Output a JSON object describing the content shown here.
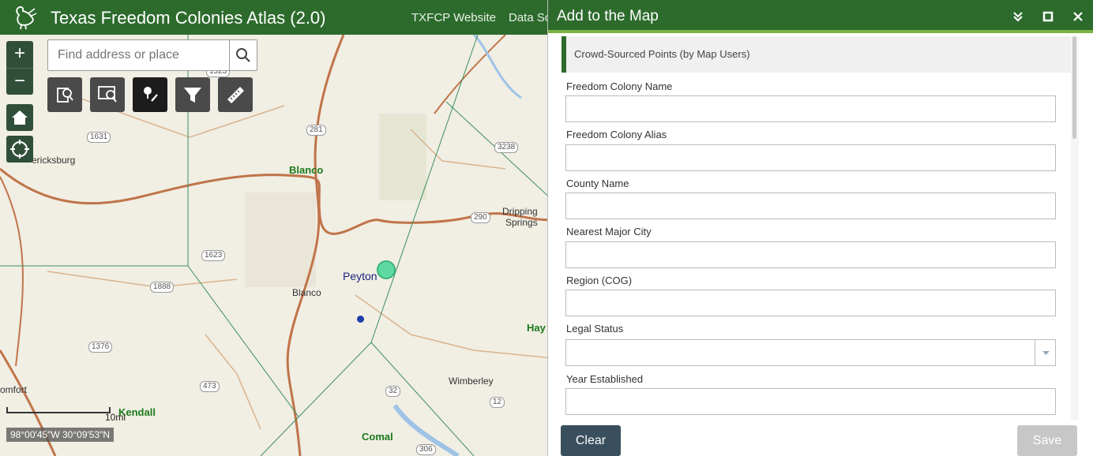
{
  "header": {
    "title": "Texas Freedom Colonies Atlas (2.0)",
    "links": [
      "TXFCP Website",
      "Data Sc"
    ]
  },
  "search": {
    "placeholder": "Find address or place"
  },
  "map": {
    "places": {
      "blanco_green": "Blanco",
      "blanco_town": "Blanco",
      "peyton": "Peyton",
      "dripping_springs_1": "Dripping",
      "dripping_springs_2": "Springs",
      "fredericksburg": "ericksburg",
      "comfort": "omfort",
      "kendall": "Kendall",
      "comal": "Comal",
      "wimberley": "Wimberley",
      "hays": "Hay"
    },
    "shields": [
      "1323",
      "281",
      "1631",
      "3238",
      "290",
      "1623",
      "1888",
      "1376",
      "473",
      "32",
      "12",
      "306"
    ],
    "scale_label": "10mi",
    "coordinates": "98°00′45″W 30°09′53″N"
  },
  "panel": {
    "title": "Add to the Map",
    "layer": "Crowd-Sourced Points (by Map Users)",
    "fields": [
      "Freedom Colony Name",
      "Freedom Colony Alias",
      "County Name",
      "Nearest Major City",
      "Region (COG)",
      "Legal Status",
      "Year Established"
    ],
    "clear_label": "Clear",
    "save_label": "Save"
  }
}
